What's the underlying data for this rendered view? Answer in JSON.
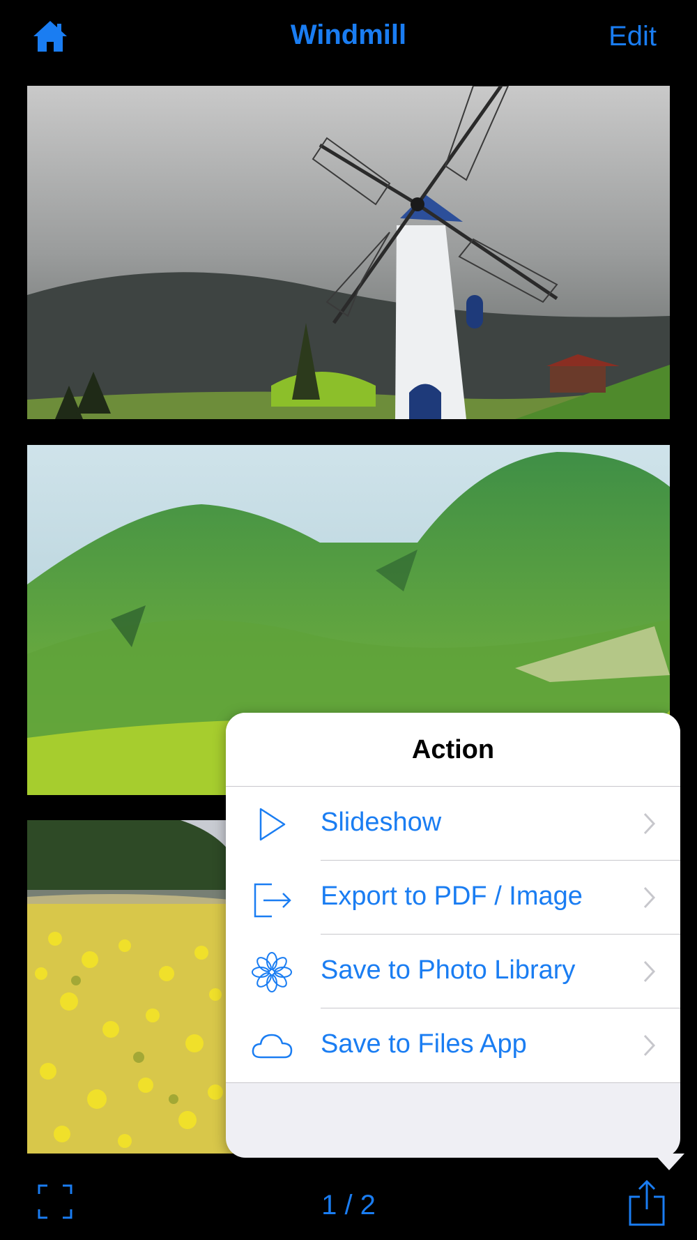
{
  "navbar": {
    "home_icon": "house-icon",
    "title": "Windmill",
    "edit_label": "Edit"
  },
  "photos": [
    {
      "subject": "windmill"
    },
    {
      "subject": "green-hills"
    },
    {
      "subject": "yellow-flower-field"
    }
  ],
  "popover": {
    "title": "Action",
    "items": [
      {
        "label": "Slideshow",
        "icon": "play-icon"
      },
      {
        "label": "Export to PDF / Image",
        "icon": "export-icon"
      },
      {
        "label": "Save to Photo Library",
        "icon": "photos-flower-icon"
      },
      {
        "label": "Save to Files App",
        "icon": "cloud-icon"
      }
    ]
  },
  "toolbar": {
    "fullscreen_icon": "fullscreen-icon",
    "page_indicator": "1 / 2",
    "share_icon": "share-icon"
  },
  "colors": {
    "accent": "#1A7DF2",
    "background": "#000000",
    "popover_bg": "#EFEFF4"
  }
}
